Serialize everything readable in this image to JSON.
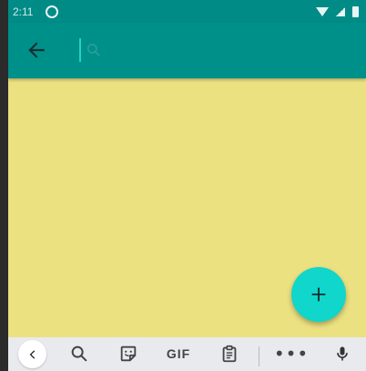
{
  "status_bar": {
    "time": "2:11"
  },
  "toolbar": {
    "back_icon": "arrow-left-icon",
    "search": {
      "value": "",
      "placeholder": "",
      "icon": "search-icon"
    }
  },
  "fab": {
    "icon": "plus-icon"
  },
  "keyboard_bar": {
    "items": [
      {
        "icon": "chevron-left-icon"
      },
      {
        "icon": "search-icon"
      },
      {
        "icon": "sticker-icon"
      },
      {
        "label": "GIF"
      },
      {
        "icon": "clipboard-icon"
      },
      {
        "label": "•••"
      },
      {
        "icon": "microphone-icon"
      }
    ]
  },
  "colors": {
    "toolbar": "#00908a",
    "status_bar": "#008b87",
    "content_bg": "#ece180",
    "fab": "#10d6cb",
    "keyboard_bar": "#e9eaee"
  }
}
